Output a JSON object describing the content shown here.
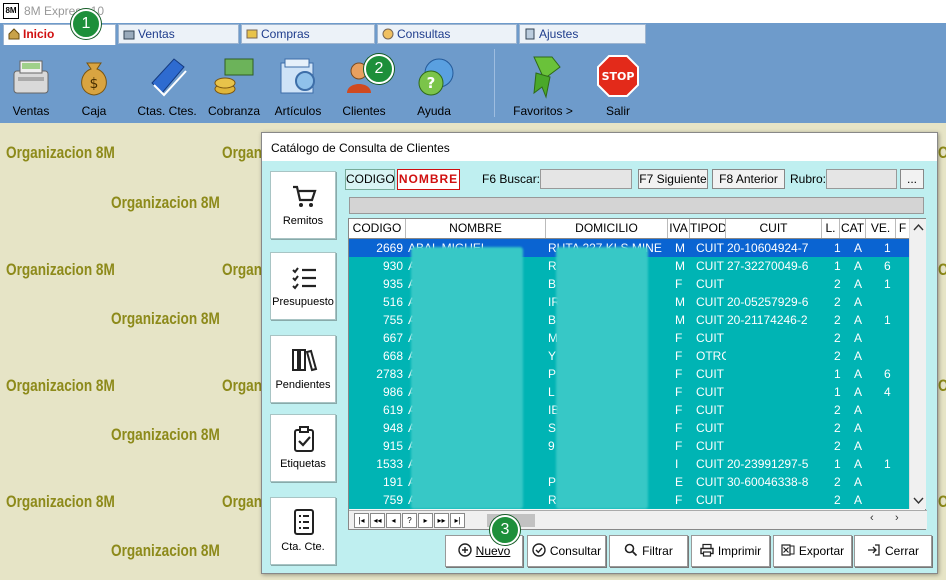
{
  "window": {
    "title": "8M Express 10"
  },
  "tabs": [
    {
      "label": "Inicio",
      "active": true
    },
    {
      "label": "Ventas"
    },
    {
      "label": "Compras"
    },
    {
      "label": "Consultas"
    },
    {
      "label": "Ajustes"
    }
  ],
  "toolbar": {
    "items": [
      {
        "label": "Ventas",
        "icon": "cash-register-icon"
      },
      {
        "label": "Caja",
        "icon": "money-bag-icon"
      },
      {
        "label": "Ctas. Ctes.",
        "icon": "ledger-book-icon"
      },
      {
        "label": "Cobranza",
        "icon": "cash-stack-icon"
      },
      {
        "label": "Artículos",
        "icon": "catalog-icon"
      },
      {
        "label": "Clientes",
        "icon": "clients-icon"
      },
      {
        "label": "Ayuda",
        "icon": "help-globe-icon"
      },
      {
        "label": "Favoritos  >",
        "icon": "ribbon-icon"
      },
      {
        "label": "Salir",
        "icon": "stop-icon"
      }
    ],
    "stop_text": "STOP"
  },
  "badges": [
    "1",
    "2",
    "3"
  ],
  "watermark": "Organizacion 8M",
  "dialog": {
    "title": "Catálogo de Consulta de Clientes",
    "sidebar": [
      {
        "label": "Remitos",
        "icon": "cart-icon"
      },
      {
        "label": "Presupuesto",
        "icon": "list-icon"
      },
      {
        "label": "Pendientes",
        "icon": "books-icon"
      },
      {
        "label": "Etiquetas",
        "icon": "clipboard-check-icon"
      },
      {
        "label": "Cta. Cte.",
        "icon": "document-list-icon"
      }
    ],
    "column_tabs": [
      {
        "label": "CODIGO"
      },
      {
        "label": "NOMBRE",
        "selected": true
      }
    ],
    "search_label": "F6 Buscar:",
    "search_value": "",
    "next_button": "F7 Siguiente",
    "prev_button": "F8 Anterior",
    "rubro_label": "Rubro:",
    "rubro_value": "",
    "rubro_button": "...",
    "grid": {
      "headers": [
        "CODIGO",
        "NOMBRE",
        "DOMICILIO",
        "IVA",
        "TIPOD",
        "CUIT",
        "L.",
        "CAT",
        "VE.",
        "F"
      ],
      "rows": [
        {
          "codigo": "2669",
          "nombre": "ABAL MIGUEL",
          "domicilio": "RUTA 227 KLS MINE",
          "iva": "M",
          "tipod": "CUIT",
          "cuit": "20-10604924-7",
          "l": "1",
          "cat": "A",
          "ve": "1",
          "selected": true
        },
        {
          "codigo": "930",
          "nombre": "A",
          "domicilio": "R",
          "iva": "M",
          "tipod": "CUIT",
          "cuit": "27-32270049-6",
          "l": "1",
          "cat": "A",
          "ve": "6"
        },
        {
          "codigo": "935",
          "nombre": "A",
          "domicilio": "B",
          "iva": "F",
          "tipod": "CUIT",
          "cuit": "",
          "l": "2",
          "cat": "A",
          "ve": "1"
        },
        {
          "codigo": "516",
          "nombre": "A",
          "domicilio": "IR",
          "iva": "M",
          "tipod": "CUIT",
          "cuit": "20-05257929-6",
          "l": "2",
          "cat": "A",
          "ve": ""
        },
        {
          "codigo": "755",
          "nombre": "A",
          "domicilio": "B",
          "iva": "M",
          "tipod": "CUIT",
          "cuit": "20-21174246-2",
          "l": "2",
          "cat": "A",
          "ve": "1"
        },
        {
          "codigo": "667",
          "nombre": "A",
          "domicilio": "M          CE",
          "iva": "F",
          "tipod": "CUIT",
          "cuit": "",
          "l": "2",
          "cat": "A",
          "ve": ""
        },
        {
          "codigo": "668",
          "nombre": "A          TER",
          "domicilio": "Y",
          "iva": "F",
          "tipod": "OTRO",
          "cuit": "",
          "l": "2",
          "cat": "A",
          "ve": ""
        },
        {
          "codigo": "2783",
          "nombre": "A          GAF",
          "domicilio": "P          324",
          "iva": "F",
          "tipod": "CUIT",
          "cuit": "",
          "l": "1",
          "cat": "A",
          "ve": "6"
        },
        {
          "codigo": "986",
          "nombre": "A",
          "domicilio": "L          15",
          "iva": "F",
          "tipod": "CUIT",
          "cuit": "",
          "l": "1",
          "cat": "A",
          "ve": "4"
        },
        {
          "codigo": "619",
          "nombre": "A",
          "domicilio": "IB",
          "iva": "F",
          "tipod": "CUIT",
          "cuit": "",
          "l": "2",
          "cat": "A",
          "ve": ""
        },
        {
          "codigo": "948",
          "nombre": "A",
          "domicilio": "S",
          "iva": "F",
          "tipod": "CUIT",
          "cuit": "",
          "l": "2",
          "cat": "A",
          "ve": ""
        },
        {
          "codigo": "915",
          "nombre": "A",
          "domicilio": "9          CE",
          "iva": "F",
          "tipod": "CUIT",
          "cuit": "",
          "l": "2",
          "cat": "A",
          "ve": ""
        },
        {
          "codigo": "1533",
          "nombre": "A",
          "domicilio": "",
          "iva": "I",
          "tipod": "CUIT",
          "cuit": "20-23991297-5",
          "l": "1",
          "cat": "A",
          "ve": "1"
        },
        {
          "codigo": "191",
          "nombre": "A          D",
          "domicilio": "P          AN",
          "iva": "E",
          "tipod": "CUIT",
          "cuit": "30-60046338-8",
          "l": "2",
          "cat": "A",
          "ve": ""
        },
        {
          "codigo": "759",
          "nombre": "A",
          "domicilio": "R",
          "iva": "F",
          "tipod": "CUIT",
          "cuit": "",
          "l": "2",
          "cat": "A",
          "ve": ""
        }
      ]
    },
    "nav_buttons": [
      "|◂",
      "◂◂",
      "◂",
      "?",
      "▸",
      "▸▸",
      "▸|"
    ],
    "actions": [
      {
        "label": "Nuevo",
        "icon": "plus-circle-icon"
      },
      {
        "label": "Consultar",
        "icon": "check-circle-icon"
      },
      {
        "label": "Filtrar",
        "icon": "magnifier-icon"
      },
      {
        "label": "Imprimir",
        "icon": "printer-icon"
      },
      {
        "label": "Exportar",
        "icon": "excel-icon"
      },
      {
        "label": "Cerrar",
        "icon": "exit-icon"
      }
    ]
  },
  "colors": {
    "toolbar": "#6e9bcb",
    "grid_rows": "#00b4b4",
    "grid_selected": "#0a64d2",
    "dialog_body": "#bfeff0",
    "watermark": "#8d8a1a",
    "badge": "#1d8f3a",
    "active_tab": "#d01010"
  }
}
